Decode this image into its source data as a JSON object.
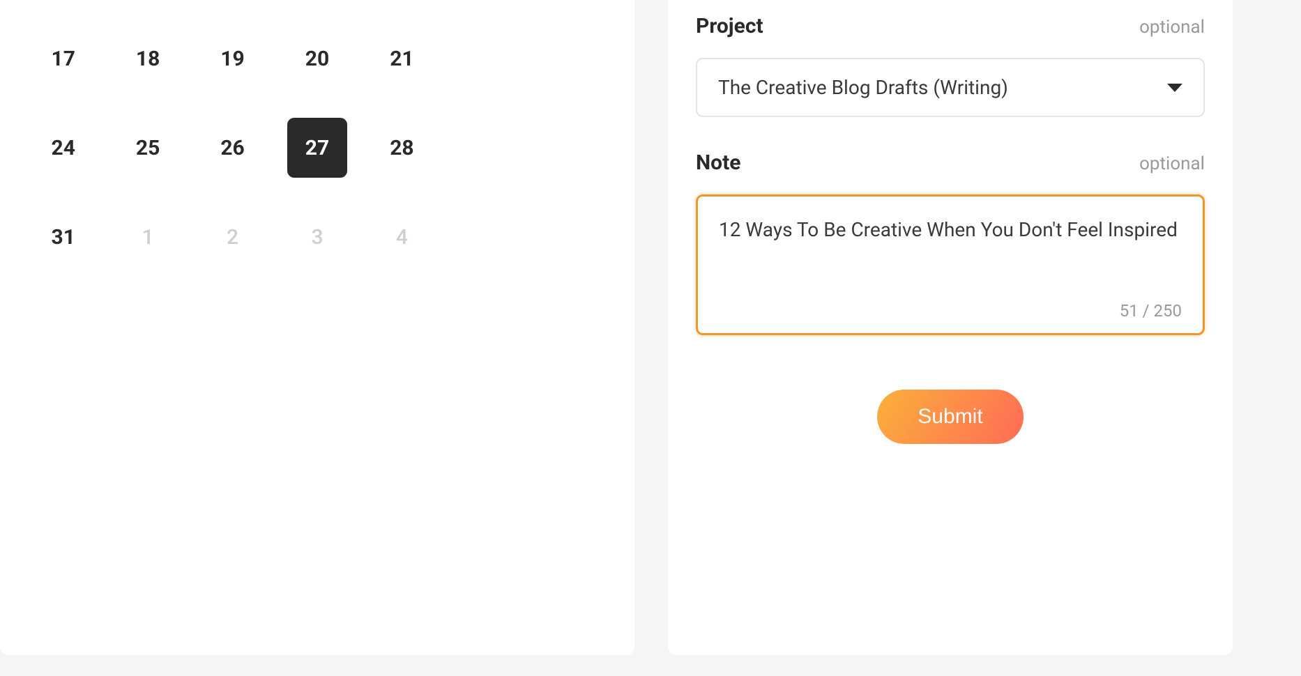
{
  "calendar": {
    "rows": [
      [
        {
          "day": "17",
          "muted": false,
          "selected": false
        },
        {
          "day": "18",
          "muted": false,
          "selected": false
        },
        {
          "day": "19",
          "muted": false,
          "selected": false
        },
        {
          "day": "20",
          "muted": false,
          "selected": false
        },
        {
          "day": "21",
          "muted": false,
          "selected": false
        },
        {
          "day": "",
          "muted": false,
          "selected": false,
          "empty": true
        },
        {
          "day": "",
          "muted": false,
          "selected": false,
          "empty": true
        }
      ],
      [
        {
          "day": "24",
          "muted": false,
          "selected": false
        },
        {
          "day": "25",
          "muted": false,
          "selected": false
        },
        {
          "day": "26",
          "muted": false,
          "selected": false
        },
        {
          "day": "27",
          "muted": false,
          "selected": true
        },
        {
          "day": "28",
          "muted": false,
          "selected": false
        },
        {
          "day": "",
          "muted": false,
          "selected": false,
          "empty": true
        },
        {
          "day": "",
          "muted": false,
          "selected": false,
          "empty": true
        }
      ],
      [
        {
          "day": "31",
          "muted": false,
          "selected": false
        },
        {
          "day": "1",
          "muted": true,
          "selected": false
        },
        {
          "day": "2",
          "muted": true,
          "selected": false
        },
        {
          "day": "3",
          "muted": true,
          "selected": false
        },
        {
          "day": "4",
          "muted": true,
          "selected": false
        },
        {
          "day": "",
          "muted": false,
          "selected": false,
          "empty": true
        },
        {
          "day": "",
          "muted": false,
          "selected": false,
          "empty": true
        }
      ]
    ]
  },
  "form": {
    "project": {
      "label": "Project",
      "optional_text": "optional",
      "selected": "The Creative Blog Drafts (Writing)"
    },
    "note": {
      "label": "Note",
      "optional_text": "optional",
      "value": "12 Ways To Be Creative When You Don't Feel Inspired",
      "counter": "51 / 250"
    },
    "submit_label": "Submit"
  }
}
